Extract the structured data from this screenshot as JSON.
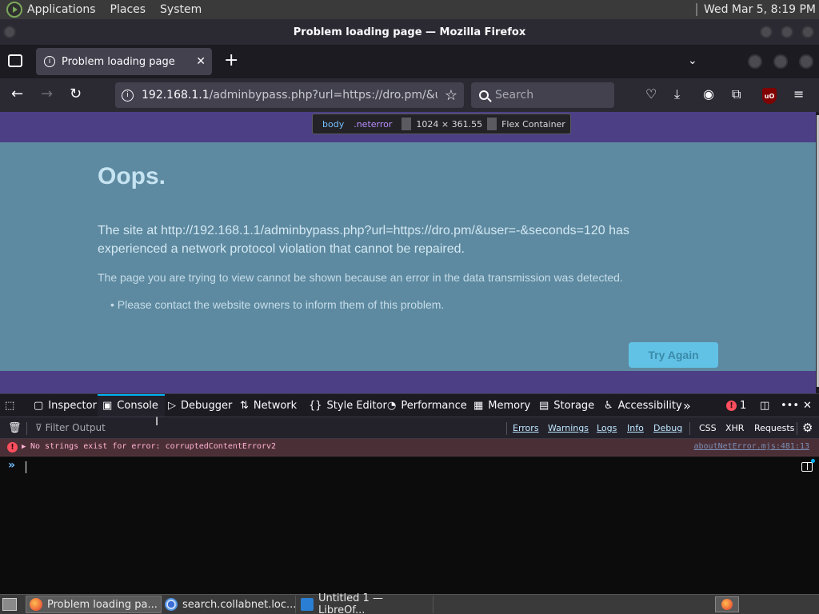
{
  "system_panel": {
    "menus": [
      "Applications",
      "Places",
      "System"
    ],
    "clock": "Wed Mar  5,  8:19 PM"
  },
  "window": {
    "title": "Problem loading page — Mozilla Firefox"
  },
  "tabs": [
    {
      "label": "Problem loading page",
      "active": true
    }
  ],
  "navbar": {
    "url_host": "192.168.1.1",
    "url_path": "/adminbypass.php?url=https://dro.pm/&user=-&",
    "search_placeholder": "Search"
  },
  "inspector_tooltip": {
    "element": "body",
    "class": ".neterror",
    "size": "1024 × 361.55",
    "badge": "Flex Container"
  },
  "error_page": {
    "title": "Oops.",
    "description": "The site at http://192.168.1.1/adminbypass.php?url=https://dro.pm/&user=-&seconds=120 has experienced a network protocol violation that cannot be repaired.",
    "explanation": "The page you are trying to view cannot be shown because an error in the data transmission was detected.",
    "bullet": "Please contact the website owners to inform them of this problem.",
    "try_again": "Try Again"
  },
  "devtools": {
    "tabs": [
      "Inspector",
      "Console",
      "Debugger",
      "Network",
      "Style Editor",
      "Performance",
      "Memory",
      "Storage",
      "Accessibility"
    ],
    "active_tab": "Console",
    "error_count": "1",
    "filter_placeholder": "Filter Output",
    "filter_buttons": [
      "Errors",
      "Warnings",
      "Logs",
      "Info",
      "Debug"
    ],
    "extra_buttons": [
      "CSS",
      "XHR",
      "Requests"
    ],
    "messages": [
      {
        "level": "error",
        "text": "No strings exist for error: corruptedContentErrorv2",
        "location": "aboutNetError.mjs:481:13"
      }
    ]
  },
  "taskbar": {
    "items": [
      {
        "label": "Problem loading pa...",
        "active": true,
        "icon_color": "#e66000"
      },
      {
        "label": "search.collabnet.loc...",
        "active": false,
        "icon_color": "#3b6fd6"
      },
      {
        "label": "Untitled 1 — LibreOf...",
        "active": false,
        "icon_color": "#2a7fd4"
      }
    ]
  }
}
